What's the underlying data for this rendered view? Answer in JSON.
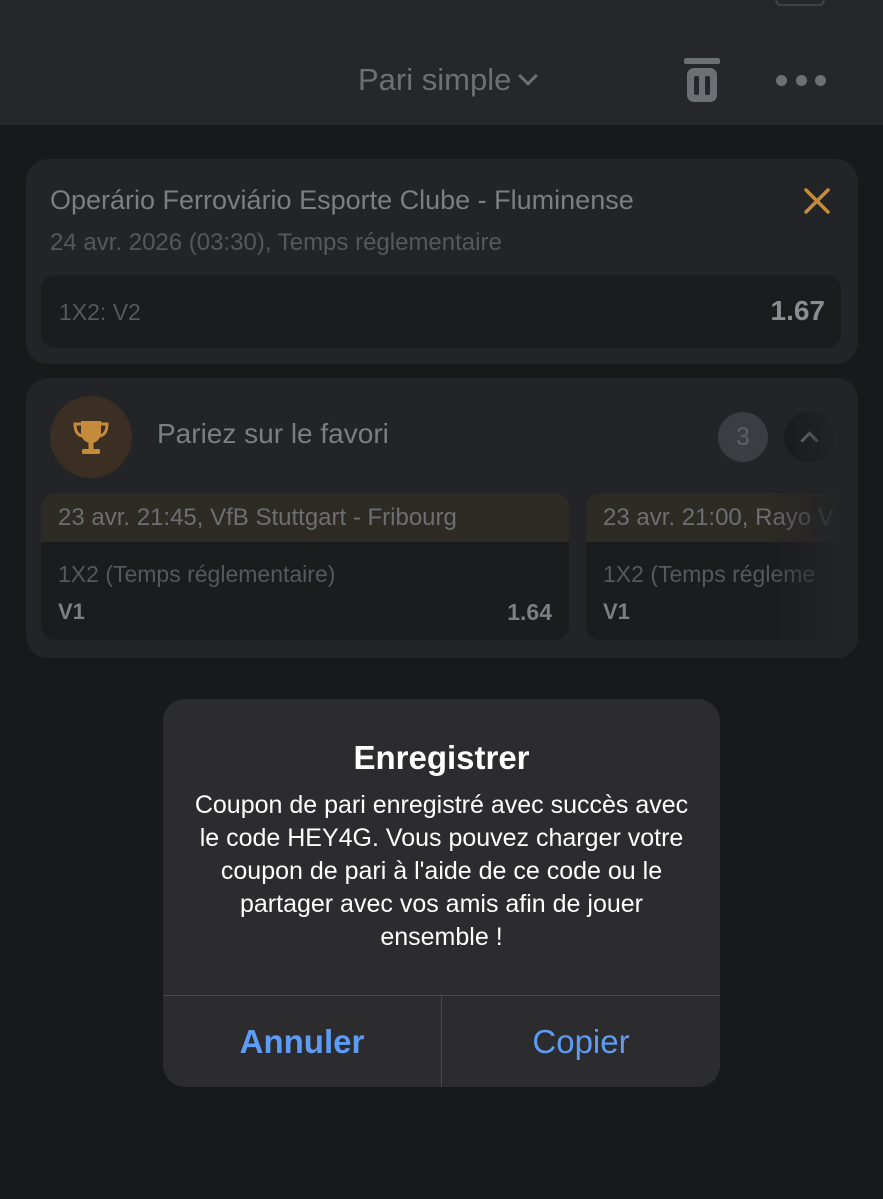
{
  "header": {
    "title": "Pari simple"
  },
  "event": {
    "title": "Operário Ferroviário Esporte Clube - Fluminense",
    "subtitle": "24 avr. 2026 (03:30), Temps réglementaire",
    "market": "1X2: V2",
    "odds": "1.67"
  },
  "favorite": {
    "title": "Pariez sur le favori",
    "count": "3",
    "matches": [
      {
        "header": "23 avr. 21:45, VfB Stuttgart - Fribourg",
        "market": "1X2 (Temps réglementaire)",
        "pick": "V1",
        "odds": "1.64"
      },
      {
        "header": "23 avr. 21:00, Rayo V",
        "market": "1X2 (Temps régleme",
        "pick": "V1"
      }
    ]
  },
  "dialog": {
    "title": "Enregistrer",
    "message": "Coupon de pari enregistré avec succès avec le code HEY4G. Vous pouvez charger votre coupon de pari à l'aide de ce code ou le partager avec vos amis afin de jouer ensemble !",
    "cancel_label": "Annuler",
    "copy_label": "Copier"
  },
  "colors": {
    "accent": "#c68a3c",
    "link": "#5e9bf4",
    "background": "#17191b",
    "card": "#222427"
  },
  "icons": {
    "trash": "trash-icon",
    "more": "more-icon",
    "close": "close-icon",
    "trophy": "trophy-icon",
    "collapse": "chevron-up-icon"
  }
}
